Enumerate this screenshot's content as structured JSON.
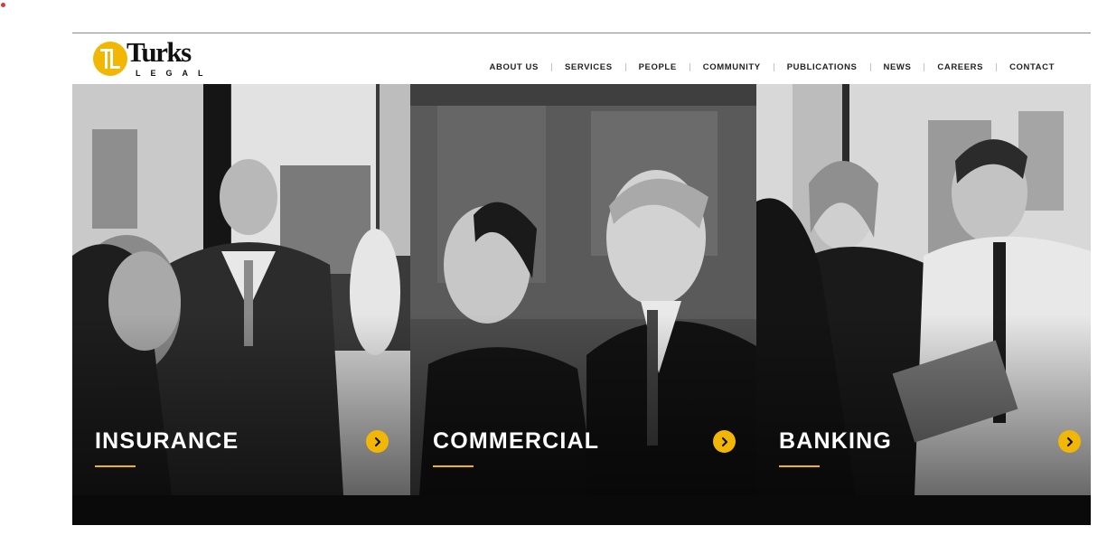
{
  "brand": {
    "name": "Turks",
    "subtitle": "LEGAL",
    "accent_color": "#f2b705",
    "mark_icon": "turks-logo-icon"
  },
  "nav": {
    "items": [
      {
        "label": "ABOUT US"
      },
      {
        "label": "SERVICES"
      },
      {
        "label": "PEOPLE"
      },
      {
        "label": "COMMUNITY"
      },
      {
        "label": "PUBLICATIONS"
      },
      {
        "label": "NEWS"
      },
      {
        "label": "CAREERS"
      },
      {
        "label": "CONTACT"
      }
    ]
  },
  "panels": [
    {
      "title": "INSURANCE",
      "icon": "chevron-right-icon"
    },
    {
      "title": "COMMERCIAL",
      "icon": "chevron-right-icon"
    },
    {
      "title": "BANKING",
      "icon": "chevron-right-icon"
    }
  ]
}
